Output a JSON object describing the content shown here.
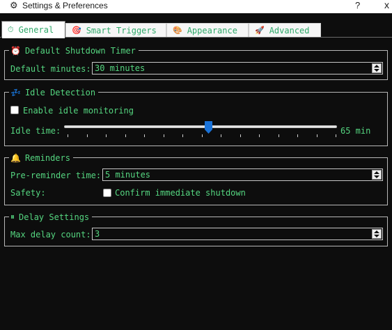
{
  "window": {
    "title": "Settings & Preferences",
    "help_glyph": "?",
    "close_glyph": "x",
    "app_icon_glyph": "⟩",
    "gear_glyph": "⚙"
  },
  "tabs": [
    {
      "label": "General",
      "icon": "⏱",
      "icon_name": "stopwatch-icon",
      "active": true
    },
    {
      "label": "Smart Triggers",
      "icon": "🎯",
      "icon_name": "target-icon",
      "active": false
    },
    {
      "label": "Appearance",
      "icon": "🎨",
      "icon_name": "palette-icon",
      "active": false
    },
    {
      "label": "Advanced",
      "icon": "🚀",
      "icon_name": "rocket-icon",
      "active": false
    }
  ],
  "shutdown_timer": {
    "title": "Default Shutdown Timer",
    "icon": "⏰",
    "default_minutes_label": "Default minutes:",
    "default_minutes_value": "30 minutes"
  },
  "idle_detection": {
    "title": "Idle Detection",
    "icon": "💤",
    "enable_label": "Enable idle monitoring",
    "enable_checked": false,
    "idle_time_label": "Idle time:",
    "idle_time_value": "65 min",
    "slider_fraction": 0.53
  },
  "reminders": {
    "title": "Reminders",
    "icon": "🔔",
    "pre_reminder_label": "Pre-reminder time:",
    "pre_reminder_value": "5 minutes",
    "safety_label": "Safety:",
    "confirm_label": "Confirm immediate shutdown",
    "confirm_checked": false
  },
  "delay_settings": {
    "title": "Delay Settings",
    "icon": "⏸",
    "max_delay_label": "Max delay count:",
    "max_delay_value": "3"
  },
  "colors": {
    "accent_green": "#55d680",
    "tab_green": "#2fa96a",
    "background": "#0d0d0d",
    "slider_handle": "#1a73d9"
  }
}
